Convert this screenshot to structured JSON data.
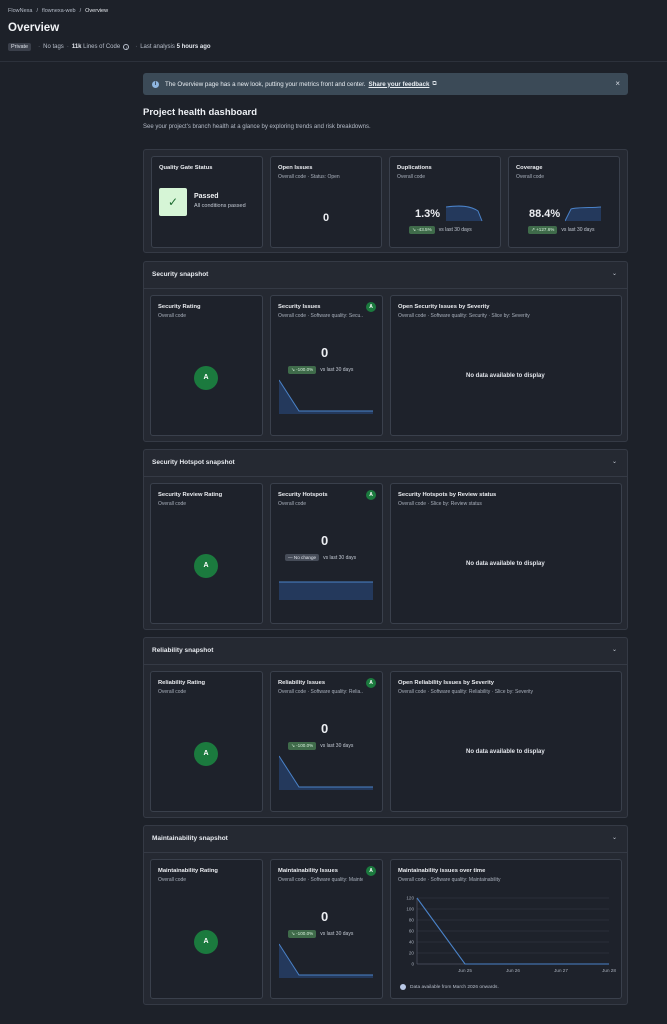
{
  "breadcrumb": [
    "FlowNexa",
    "/",
    "flownexa-web",
    "/",
    "Overview"
  ],
  "page_title": "Overview",
  "meta": {
    "visibility": "Private",
    "tags": "No tags",
    "loc_value": "11k",
    "loc_label": "Lines of Code",
    "analysis_prefix": "Last analysis",
    "analysis_value": "5 hours ago"
  },
  "banner": {
    "text": "The Overview page has a new look, putting your metrics front and center.",
    "link": "Share your feedback",
    "close": "×"
  },
  "heading": {
    "title": "Project health dashboard",
    "subtitle": "See your project's branch health at a glance by exploring trends and risk breakdowns."
  },
  "summary": {
    "quality_gate": {
      "title": "Quality Gate Status",
      "status": "Passed",
      "detail": "All conditions passed",
      "icon": "check-icon"
    },
    "open_issues": {
      "title": "Open Issues",
      "sub": "Overall code · Status: Open",
      "value": "0"
    },
    "duplications": {
      "title": "Duplications",
      "sub": "Overall code",
      "value": "1.3%",
      "delta": "↘ -43.5%",
      "delta_suffix": "vs last 30 days"
    },
    "coverage": {
      "title": "Coverage",
      "sub": "Overall code",
      "value": "88.4%",
      "delta": "↗ +127.6%",
      "delta_suffix": "vs last 30 days"
    }
  },
  "security": {
    "header": "Security snapshot",
    "chevron": "⌄",
    "rating": {
      "title": "Security Rating",
      "sub": "Overall code",
      "grade": "A"
    },
    "issues": {
      "title": "Security Issues",
      "sub": "Overall code · Software quality: Secu...",
      "grade": "A",
      "value": "0",
      "delta": "↘ -100.0%",
      "delta_suffix": "vs last 30 days"
    },
    "breakdown": {
      "title": "Open Security Issues by Severity",
      "sub": "Overall code · Software quality: Security · Slice by: Severity",
      "empty": "No data available to display"
    }
  },
  "hotspots": {
    "header": "Security Hotspot snapshot",
    "chevron": "⌄",
    "rating": {
      "title": "Security Review Rating",
      "sub": "Overall code",
      "grade": "A"
    },
    "issues": {
      "title": "Security Hotspots",
      "sub": "Overall code",
      "grade": "A",
      "value": "0",
      "delta": "— No change",
      "delta_suffix": "vs last 30 days"
    },
    "breakdown": {
      "title": "Security Hotspots by Review status",
      "sub": "Overall code · Slice by: Review status",
      "empty": "No data available to display"
    }
  },
  "reliability": {
    "header": "Reliability snapshot",
    "chevron": "⌄",
    "rating": {
      "title": "Reliability Rating",
      "sub": "Overall code",
      "grade": "A"
    },
    "issues": {
      "title": "Reliability Issues",
      "sub": "Overall code · Software quality: Relia...",
      "grade": "A",
      "value": "0",
      "delta": "↘ -100.0%",
      "delta_suffix": "vs last 30 days"
    },
    "breakdown": {
      "title": "Open Reliability Issues by Severity",
      "sub": "Overall code · Software quality: Reliability · Slice by: Severity",
      "empty": "No data available to display"
    }
  },
  "maintainability": {
    "header": "Maintainability snapshot",
    "chevron": "⌄",
    "rating": {
      "title": "Maintainability Rating",
      "sub": "Overall code",
      "grade": "A"
    },
    "issues": {
      "title": "Maintainability Issues",
      "sub": "Overall code · Software quality: Mainte...",
      "grade": "A",
      "value": "0",
      "delta": "↘ -100.0%",
      "delta_suffix": "vs last 30 days"
    },
    "chart_card": {
      "title": "Maintainability issues over time",
      "sub": "Overall code · Software quality: Maintainability",
      "legend": "Data available from March 2026 onwards."
    }
  },
  "chart_data": {
    "type": "line",
    "title": "Maintainability issues over time",
    "xlabel": "",
    "ylabel": "",
    "x": [
      "Jun 24",
      "Jun 25",
      "Jun 26",
      "Jun 27",
      "Jun 28"
    ],
    "series": [
      {
        "values": [
          120,
          0,
          0,
          0,
          0
        ]
      }
    ],
    "x_ticks": [
      "Jun 25",
      "Jun 26",
      "Jun 27",
      "Jun 28"
    ],
    "y_ticks": [
      0,
      20,
      40,
      60,
      80,
      100,
      120
    ],
    "ylim": [
      0,
      120
    ],
    "grid": true,
    "color": "#4a82c8"
  },
  "colors": {
    "accent_green": "#1b7a3e",
    "line_blue": "#4a82c8",
    "fill_blue": "#24395c"
  }
}
